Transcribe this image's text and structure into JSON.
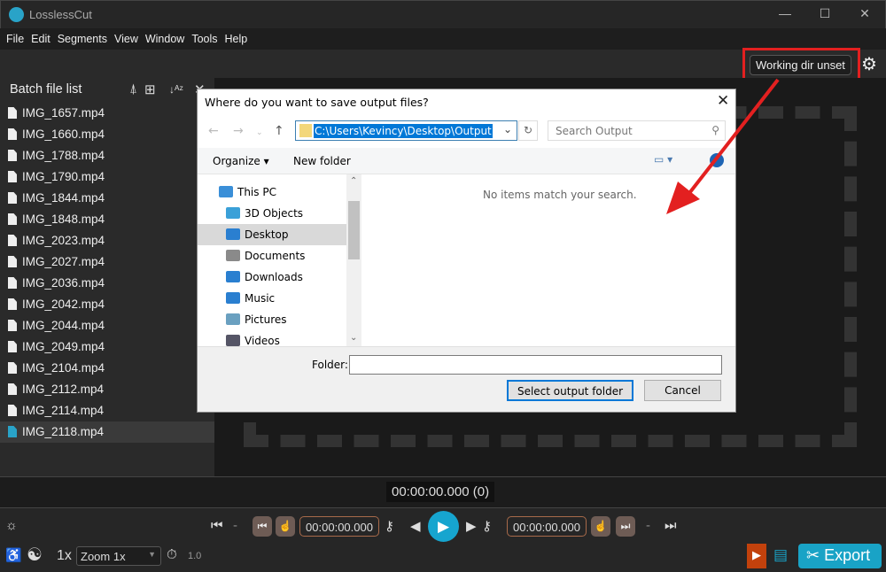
{
  "app": {
    "title": "LosslessCut",
    "window_controls": [
      "—",
      "☐",
      "✕"
    ]
  },
  "menu": [
    "File",
    "Edit",
    "Segments",
    "View",
    "Window",
    "Tools",
    "Help"
  ],
  "toolbar": {
    "working_dir": "Working dir unset"
  },
  "sidebar": {
    "title": "Batch file list",
    "files": [
      "IMG_1657.mp4",
      "IMG_1660.mp4",
      "IMG_1788.mp4",
      "IMG_1790.mp4",
      "IMG_1844.mp4",
      "IMG_1848.mp4",
      "IMG_2023.mp4",
      "IMG_2027.mp4",
      "IMG_2036.mp4",
      "IMG_2042.mp4",
      "IMG_2044.mp4",
      "IMG_2049.mp4",
      "IMG_2104.mp4",
      "IMG_2112.mp4",
      "IMG_2114.mp4",
      "IMG_2118.mp4"
    ],
    "selected": "IMG_2118.mp4"
  },
  "timeline": {
    "timecode": "00:00:00.000 (0)"
  },
  "controls": {
    "start_time": "00:00:00.000",
    "end_time": "00:00:00.000",
    "speed": "1x",
    "zoom": "Zoom 1x",
    "playback_rate": "1.0",
    "export_label": "Export",
    "separator": "-"
  },
  "dialog": {
    "title": "Where do you want to save output files?",
    "address": "C:\\Users\\Kevincy\\Desktop\\Output",
    "search_placeholder": "Search Output",
    "organize": "Organize ▾",
    "new_folder": "New folder",
    "empty_message": "No items match your search.",
    "tree": [
      "This PC",
      "3D Objects",
      "Desktop",
      "Documents",
      "Downloads",
      "Music",
      "Pictures",
      "Videos"
    ],
    "tree_selected": "Desktop",
    "folder_label": "Folder:",
    "folder_value": "",
    "select_button": "Select output folder",
    "cancel_button": "Cancel"
  },
  "colors": {
    "accent": "#19a3c6",
    "highlight_box": "#e32020",
    "arrow": "#e32020"
  }
}
